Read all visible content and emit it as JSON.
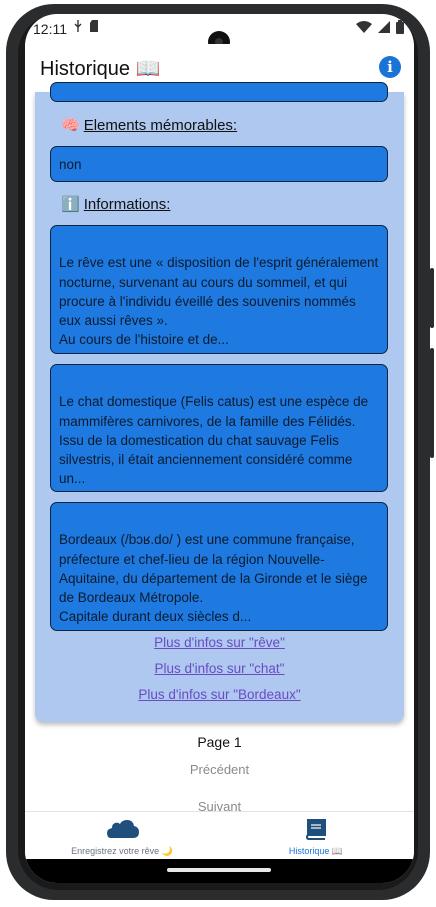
{
  "status_bar": {
    "time": "12:11"
  },
  "header": {
    "title": "Historique 📖",
    "info_icon_glyph": "i"
  },
  "sections": {
    "memorable_label": "Elements mémorables:",
    "memorable_emoji": "🧠",
    "memorable_value": "non",
    "info_label": "Informations:",
    "info_emoji": "ℹ️"
  },
  "info_cards": [
    {
      "text": "Le rêve est une « disposition de l'esprit généralement nocturne, survenant au cours du sommeil, et qui procure à l'individu éveillé des souvenirs nommés eux aussi rêves ».\nAu cours de l'histoire et de..."
    },
    {
      "text": "Le chat domestique (Felis catus) est une espèce de mammifères carnivores, de la famille des Félidés. Issu de la domestication du chat sauvage Felis silvestris, il était anciennement considéré comme un..."
    },
    {
      "text": "Bordeaux (/bɔʁ.do/ ) est une commune française, préfecture et chef-lieu de la région Nouvelle-Aquitaine, du département de la Gironde et le siège de Bordeaux Métropole.\nCapitale durant deux siècles d..."
    }
  ],
  "links": [
    "Plus d'infos sur \"rêve\"",
    "Plus d'infos sur \"chat\"",
    "Plus d'infos sur \"Bordeaux\""
  ],
  "pager": {
    "page_label": "Page 1",
    "prev_label": "Précédent",
    "next_label": "Suivant"
  },
  "bottom_nav": {
    "items": [
      {
        "label": "Enregistrez votre rêve 🌙",
        "icon": "cloud-icon",
        "active": false
      },
      {
        "label": "Historique 📖",
        "icon": "book-icon",
        "active": true
      }
    ]
  },
  "colors": {
    "card_background": "#aec8ef",
    "box_blue": "#1e7ae0",
    "accent_blue": "#1a73d6",
    "link_purple": "#6a4bc4",
    "active_nav": "#1a73d6",
    "inactive_nav": "#6b7280"
  }
}
